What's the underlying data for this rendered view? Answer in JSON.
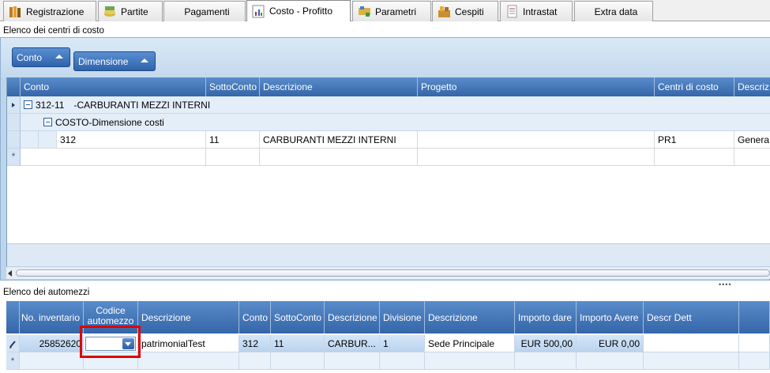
{
  "tabs": [
    {
      "label": "Registrazione",
      "icon": "books-icon"
    },
    {
      "label": "Partite",
      "icon": "money-icon"
    },
    {
      "label": "Pagamenti",
      "icon": ""
    },
    {
      "label": "Costo - Profitto",
      "icon": "chart-icon"
    },
    {
      "label": "Parametri",
      "icon": "parameters-icon"
    },
    {
      "label": "Cespiti",
      "icon": "assets-icon"
    },
    {
      "label": "Intrastat",
      "icon": "document-icon"
    },
    {
      "label": "Extra data",
      "icon": ""
    }
  ],
  "cost_centers": {
    "section_label": "Elenco dei centri di costo",
    "group_buttons": [
      "Conto",
      "Dimensione"
    ],
    "columns": [
      "Conto",
      "SottoConto",
      "Descrizione",
      "Progetto",
      "Centri di costo",
      "Descriz"
    ],
    "group_level1": {
      "code": "312-11",
      "label": "-CARBURANTI MEZZI INTERNI"
    },
    "group_level2": {
      "label": "COSTO-Dimensione costi"
    },
    "rows": [
      {
        "conto": "312",
        "sottoconto": "11",
        "descrizione": "CARBURANTI MEZZI INTERNI",
        "progetto": "",
        "centri": "PR1",
        "descriz": "Genera"
      }
    ],
    "new_row_marker": "*"
  },
  "vehicles": {
    "section_label": "Elenco dei automezzi",
    "columns": [
      "No. inventario",
      "Codice automezzo",
      "Descrizione",
      "Conto",
      "SottoConto",
      "Descrizione",
      "Divisione",
      "Descrizione",
      "Importo dare",
      "Importo Avere",
      "Descr Dett",
      ""
    ],
    "rows": [
      {
        "inventario": "25852620",
        "codice": "",
        "descrizione": "patrimonialTest",
        "conto": "312",
        "sottoconto": "11",
        "descr_conto": "CARBUR...",
        "divisione": "1",
        "descr_div": "Sede Principale",
        "dare": "EUR 500,00",
        "avere": "EUR 0,00",
        "dett": ""
      }
    ],
    "new_row_marker": "*"
  },
  "colors": {
    "header_blue": "#3466a8",
    "panel_blue": "#bdd5ec",
    "highlight_red": "#e00000"
  }
}
